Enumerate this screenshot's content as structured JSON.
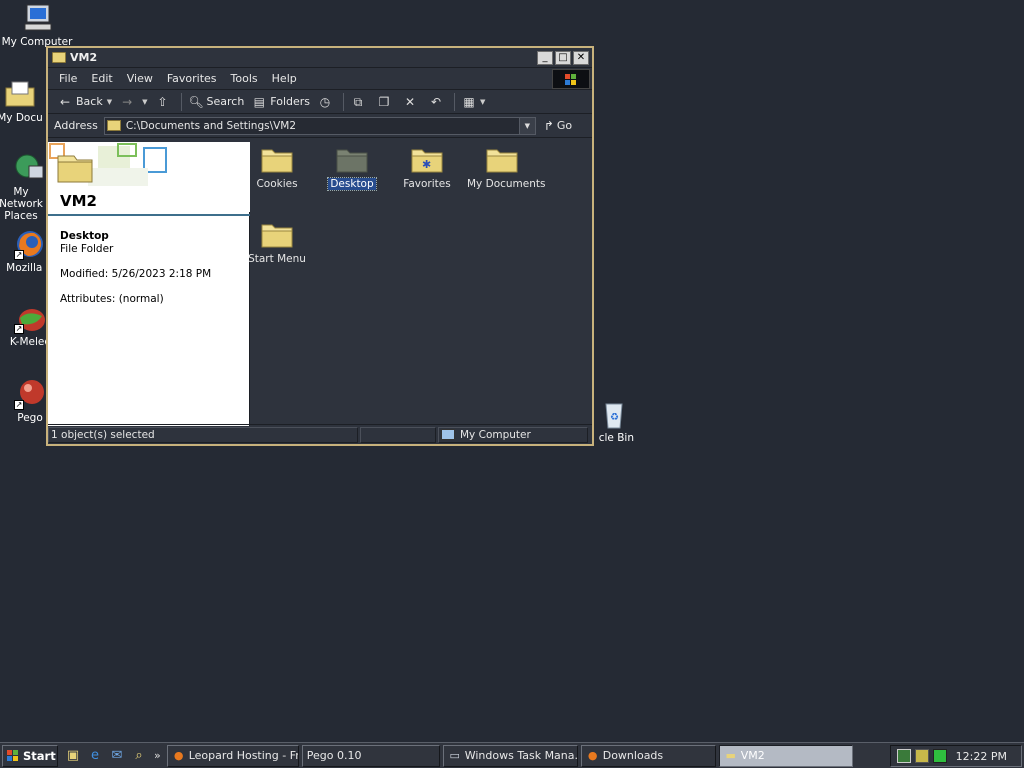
{
  "desktop": {
    "icons": [
      {
        "label": "My Computer",
        "icon": "computer-icon"
      },
      {
        "label": "My Docu",
        "icon": "documents-icon"
      },
      {
        "label": "My Network Places",
        "icon": "network-icon"
      },
      {
        "label": "Mozilla Fi",
        "icon": "firefox-icon"
      },
      {
        "label": "K-Melec",
        "icon": "kmeleon-icon"
      },
      {
        "label": "Pego",
        "icon": "pego-icon"
      },
      {
        "label": "cle Bin",
        "icon": "recycle-bin-icon"
      }
    ]
  },
  "window": {
    "title": "VM2",
    "menu": [
      "File",
      "Edit",
      "View",
      "Favorites",
      "Tools",
      "Help"
    ],
    "toolbar": {
      "back": "Back",
      "search": "Search",
      "folders": "Folders"
    },
    "address": {
      "label": "Address",
      "value": "C:\\Documents and Settings\\VM2",
      "go": "Go"
    },
    "info": {
      "title": "VM2",
      "name": "Desktop",
      "type": "File Folder",
      "modified": "Modified: 5/26/2023 2:18 PM",
      "attributes": "Attributes: (normal)"
    },
    "items": [
      {
        "label": "Cookies",
        "icon": "folder-icon",
        "selected": false
      },
      {
        "label": "Desktop",
        "icon": "folder-icon",
        "selected": true
      },
      {
        "label": "Favorites",
        "icon": "favorites-folder-icon",
        "selected": false
      },
      {
        "label": "My Documents",
        "icon": "folder-icon",
        "selected": false
      },
      {
        "label": "Start Menu",
        "icon": "folder-icon",
        "selected": false
      }
    ],
    "status": {
      "selection": "1 object(s) selected",
      "zone": "My Computer"
    }
  },
  "taskbar": {
    "start": "Start",
    "tasks": [
      {
        "label": "Leopard Hosting - Fr...",
        "icon": "firefox-icon"
      },
      {
        "label": "Pego 0.10",
        "icon": ""
      },
      {
        "label": "Windows Task Mana...",
        "icon": "task-manager-icon"
      },
      {
        "label": "Downloads",
        "icon": "firefox-icon"
      },
      {
        "label": "VM2",
        "icon": "folder-icon"
      }
    ],
    "clock": "12:22 PM"
  },
  "colors": {
    "desktop": "#252a34",
    "window_frame": "#c8b27c",
    "selection": "#274c8e",
    "folder": "#e8d37a"
  }
}
